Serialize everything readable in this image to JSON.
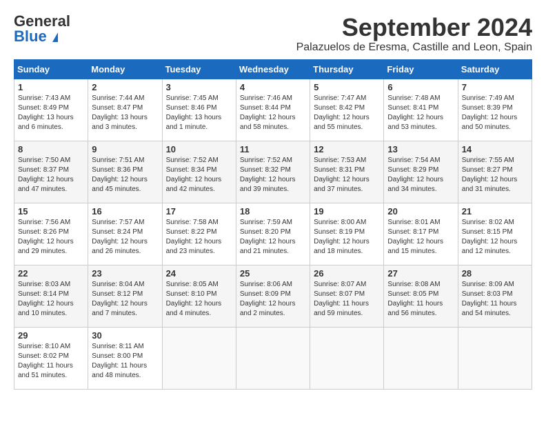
{
  "header": {
    "logo_general": "General",
    "logo_blue": "Blue",
    "month_title": "September 2024",
    "location": "Palazuelos de Eresma, Castille and Leon, Spain"
  },
  "days_of_week": [
    "Sunday",
    "Monday",
    "Tuesday",
    "Wednesday",
    "Thursday",
    "Friday",
    "Saturday"
  ],
  "weeks": [
    [
      {
        "day": "1",
        "sunrise": "Sunrise: 7:43 AM",
        "sunset": "Sunset: 8:49 PM",
        "daylight": "Daylight: 13 hours and 6 minutes."
      },
      {
        "day": "2",
        "sunrise": "Sunrise: 7:44 AM",
        "sunset": "Sunset: 8:47 PM",
        "daylight": "Daylight: 13 hours and 3 minutes."
      },
      {
        "day": "3",
        "sunrise": "Sunrise: 7:45 AM",
        "sunset": "Sunset: 8:46 PM",
        "daylight": "Daylight: 13 hours and 1 minute."
      },
      {
        "day": "4",
        "sunrise": "Sunrise: 7:46 AM",
        "sunset": "Sunset: 8:44 PM",
        "daylight": "Daylight: 12 hours and 58 minutes."
      },
      {
        "day": "5",
        "sunrise": "Sunrise: 7:47 AM",
        "sunset": "Sunset: 8:42 PM",
        "daylight": "Daylight: 12 hours and 55 minutes."
      },
      {
        "day": "6",
        "sunrise": "Sunrise: 7:48 AM",
        "sunset": "Sunset: 8:41 PM",
        "daylight": "Daylight: 12 hours and 53 minutes."
      },
      {
        "day": "7",
        "sunrise": "Sunrise: 7:49 AM",
        "sunset": "Sunset: 8:39 PM",
        "daylight": "Daylight: 12 hours and 50 minutes."
      }
    ],
    [
      {
        "day": "8",
        "sunrise": "Sunrise: 7:50 AM",
        "sunset": "Sunset: 8:37 PM",
        "daylight": "Daylight: 12 hours and 47 minutes."
      },
      {
        "day": "9",
        "sunrise": "Sunrise: 7:51 AM",
        "sunset": "Sunset: 8:36 PM",
        "daylight": "Daylight: 12 hours and 45 minutes."
      },
      {
        "day": "10",
        "sunrise": "Sunrise: 7:52 AM",
        "sunset": "Sunset: 8:34 PM",
        "daylight": "Daylight: 12 hours and 42 minutes."
      },
      {
        "day": "11",
        "sunrise": "Sunrise: 7:52 AM",
        "sunset": "Sunset: 8:32 PM",
        "daylight": "Daylight: 12 hours and 39 minutes."
      },
      {
        "day": "12",
        "sunrise": "Sunrise: 7:53 AM",
        "sunset": "Sunset: 8:31 PM",
        "daylight": "Daylight: 12 hours and 37 minutes."
      },
      {
        "day": "13",
        "sunrise": "Sunrise: 7:54 AM",
        "sunset": "Sunset: 8:29 PM",
        "daylight": "Daylight: 12 hours and 34 minutes."
      },
      {
        "day": "14",
        "sunrise": "Sunrise: 7:55 AM",
        "sunset": "Sunset: 8:27 PM",
        "daylight": "Daylight: 12 hours and 31 minutes."
      }
    ],
    [
      {
        "day": "15",
        "sunrise": "Sunrise: 7:56 AM",
        "sunset": "Sunset: 8:26 PM",
        "daylight": "Daylight: 12 hours and 29 minutes."
      },
      {
        "day": "16",
        "sunrise": "Sunrise: 7:57 AM",
        "sunset": "Sunset: 8:24 PM",
        "daylight": "Daylight: 12 hours and 26 minutes."
      },
      {
        "day": "17",
        "sunrise": "Sunrise: 7:58 AM",
        "sunset": "Sunset: 8:22 PM",
        "daylight": "Daylight: 12 hours and 23 minutes."
      },
      {
        "day": "18",
        "sunrise": "Sunrise: 7:59 AM",
        "sunset": "Sunset: 8:20 PM",
        "daylight": "Daylight: 12 hours and 21 minutes."
      },
      {
        "day": "19",
        "sunrise": "Sunrise: 8:00 AM",
        "sunset": "Sunset: 8:19 PM",
        "daylight": "Daylight: 12 hours and 18 minutes."
      },
      {
        "day": "20",
        "sunrise": "Sunrise: 8:01 AM",
        "sunset": "Sunset: 8:17 PM",
        "daylight": "Daylight: 12 hours and 15 minutes."
      },
      {
        "day": "21",
        "sunrise": "Sunrise: 8:02 AM",
        "sunset": "Sunset: 8:15 PM",
        "daylight": "Daylight: 12 hours and 12 minutes."
      }
    ],
    [
      {
        "day": "22",
        "sunrise": "Sunrise: 8:03 AM",
        "sunset": "Sunset: 8:14 PM",
        "daylight": "Daylight: 12 hours and 10 minutes."
      },
      {
        "day": "23",
        "sunrise": "Sunrise: 8:04 AM",
        "sunset": "Sunset: 8:12 PM",
        "daylight": "Daylight: 12 hours and 7 minutes."
      },
      {
        "day": "24",
        "sunrise": "Sunrise: 8:05 AM",
        "sunset": "Sunset: 8:10 PM",
        "daylight": "Daylight: 12 hours and 4 minutes."
      },
      {
        "day": "25",
        "sunrise": "Sunrise: 8:06 AM",
        "sunset": "Sunset: 8:09 PM",
        "daylight": "Daylight: 12 hours and 2 minutes."
      },
      {
        "day": "26",
        "sunrise": "Sunrise: 8:07 AM",
        "sunset": "Sunset: 8:07 PM",
        "daylight": "Daylight: 11 hours and 59 minutes."
      },
      {
        "day": "27",
        "sunrise": "Sunrise: 8:08 AM",
        "sunset": "Sunset: 8:05 PM",
        "daylight": "Daylight: 11 hours and 56 minutes."
      },
      {
        "day": "28",
        "sunrise": "Sunrise: 8:09 AM",
        "sunset": "Sunset: 8:03 PM",
        "daylight": "Daylight: 11 hours and 54 minutes."
      }
    ],
    [
      {
        "day": "29",
        "sunrise": "Sunrise: 8:10 AM",
        "sunset": "Sunset: 8:02 PM",
        "daylight": "Daylight: 11 hours and 51 minutes."
      },
      {
        "day": "30",
        "sunrise": "Sunrise: 8:11 AM",
        "sunset": "Sunset: 8:00 PM",
        "daylight": "Daylight: 11 hours and 48 minutes."
      },
      null,
      null,
      null,
      null,
      null
    ]
  ]
}
